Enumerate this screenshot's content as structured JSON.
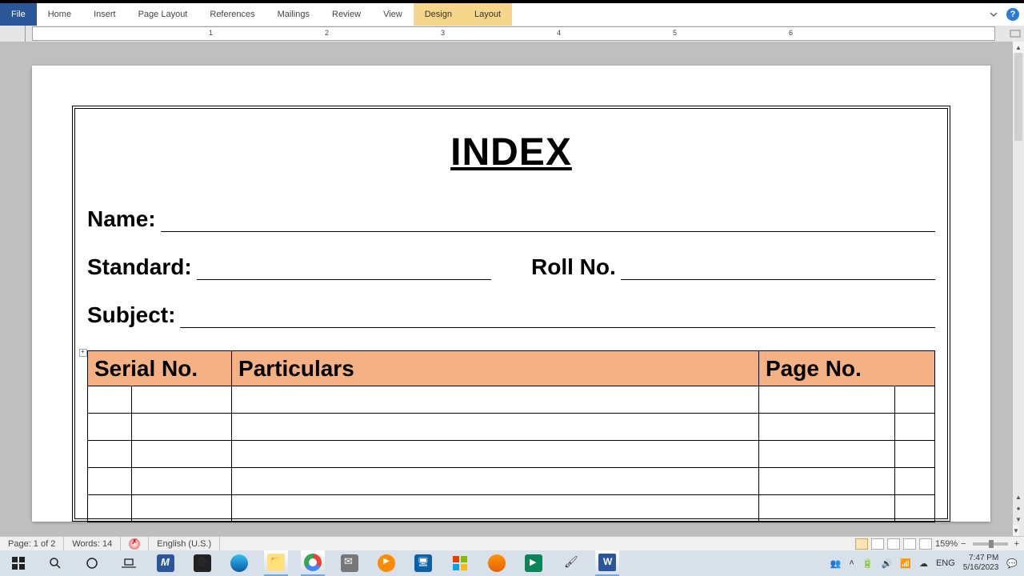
{
  "ribbon": {
    "file": "File",
    "tabs": [
      "Home",
      "Insert",
      "Page Layout",
      "References",
      "Mailings",
      "Review",
      "View"
    ],
    "context_tabs": [
      "Design",
      "Layout"
    ]
  },
  "ruler": {
    "numbers": [
      "1",
      "2",
      "3",
      "4",
      "5",
      "6"
    ]
  },
  "document": {
    "title": "INDEX",
    "fields": {
      "name_label": "Name:",
      "standard_label": "Standard:",
      "roll_label": "Roll No.",
      "subject_label": "Subject:"
    },
    "table": {
      "headers": [
        "Serial No.",
        "Particulars",
        "Page No."
      ],
      "col_widths": [
        "70px",
        "110px",
        "670px",
        "170px",
        "50px"
      ],
      "row_count": 5
    }
  },
  "statusbar": {
    "page": "Page: 1 of 2",
    "words": "Words: 14",
    "language": "English (U.S.)",
    "zoom": "159%"
  },
  "taskbar": {
    "clock_time": "7:47 PM",
    "clock_date": "5/16/2023",
    "lang": "ENG"
  }
}
